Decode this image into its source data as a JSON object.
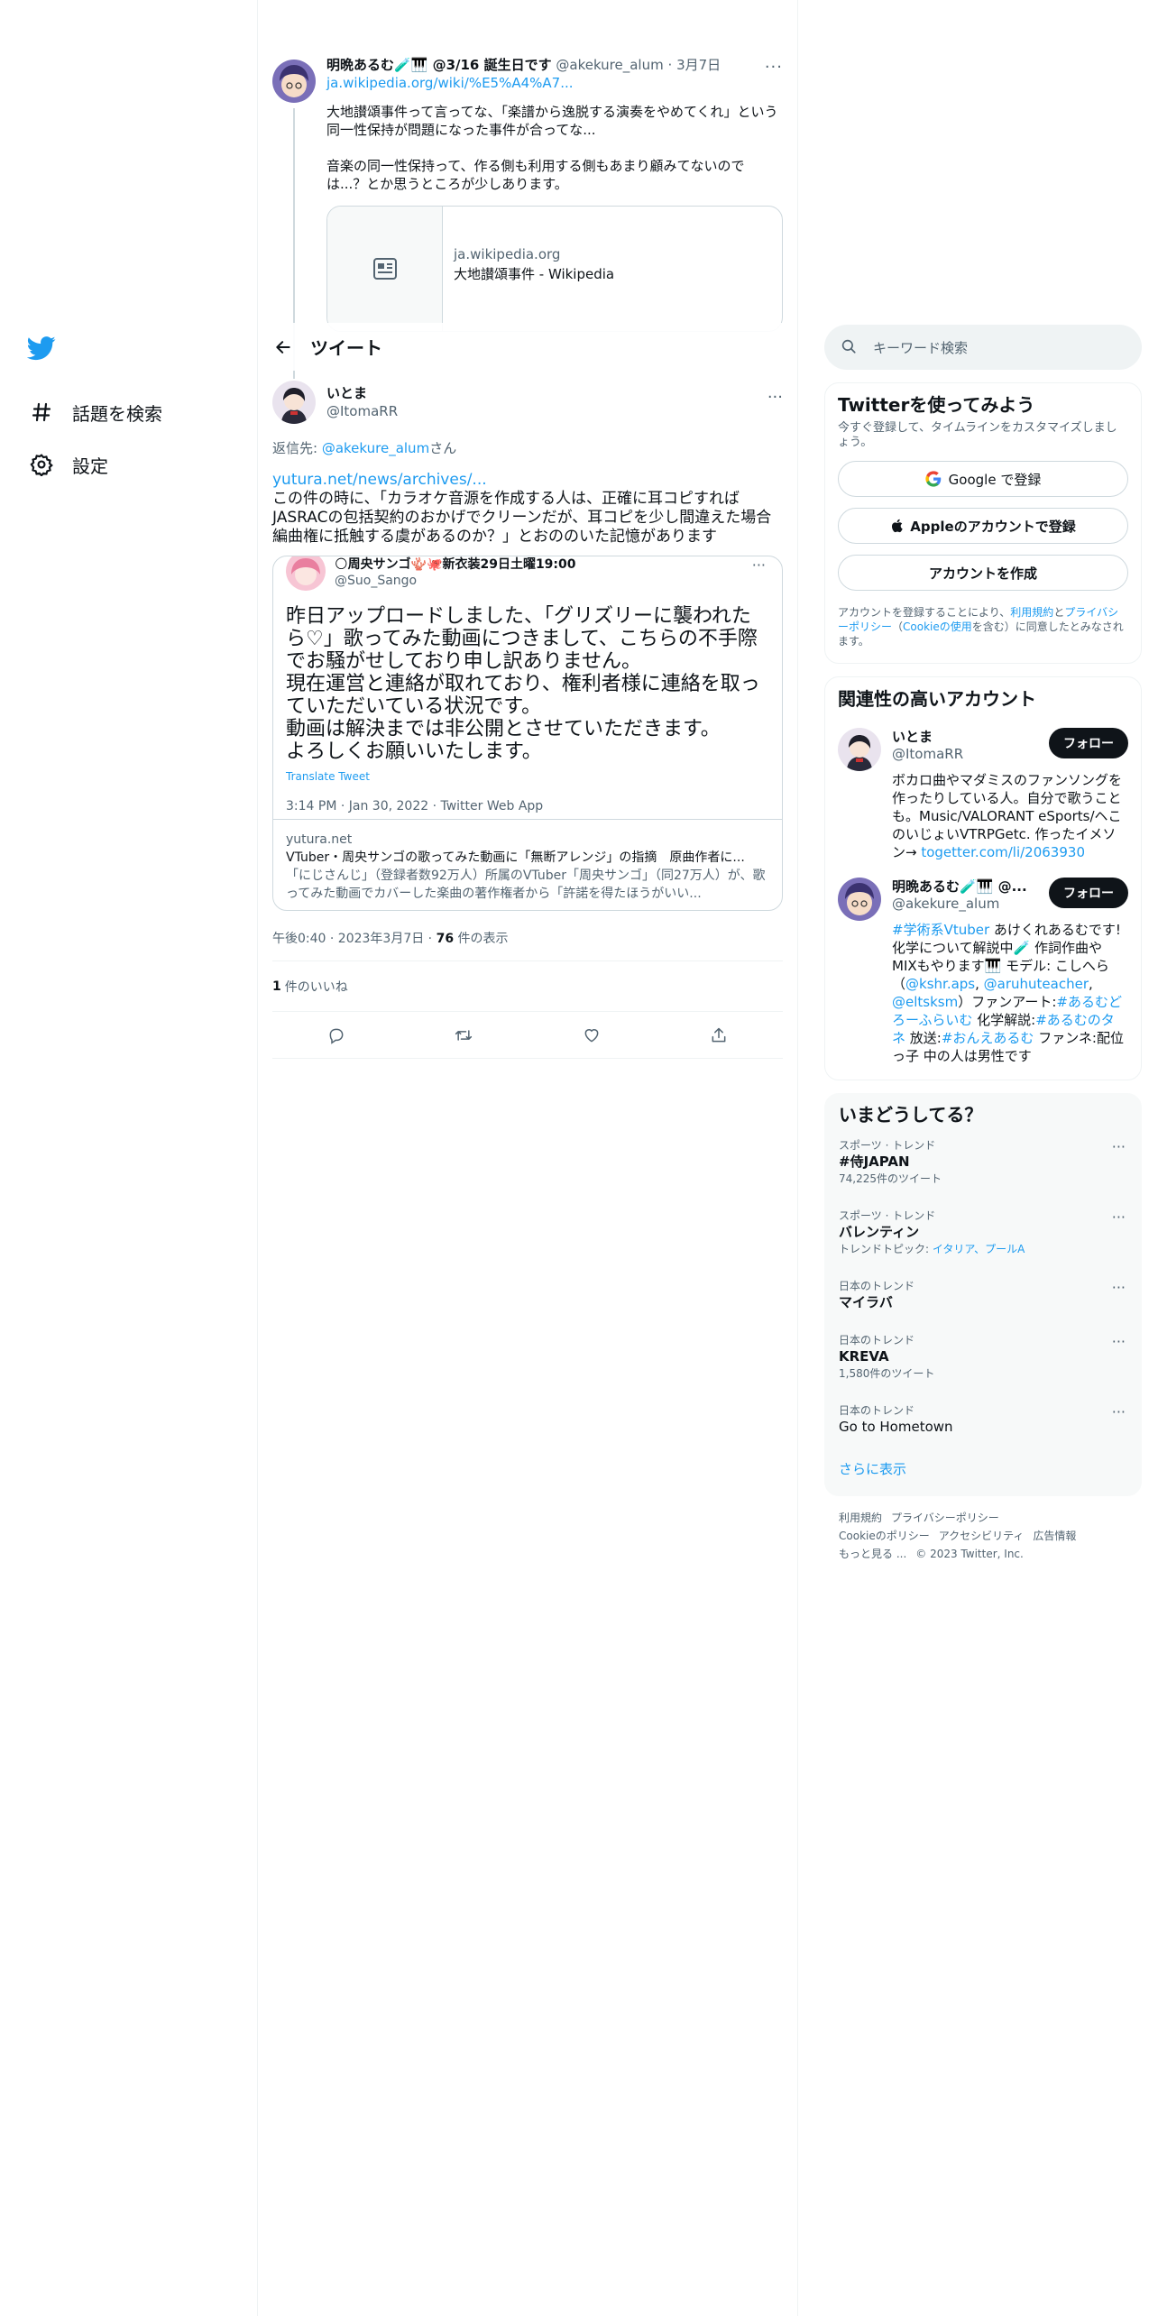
{
  "nav": {
    "items": [
      {
        "label": "話題を検索",
        "icon": "hashtag-icon"
      },
      {
        "label": "設定",
        "icon": "gear-icon"
      }
    ]
  },
  "parent_tweet": {
    "name": "明晩あるむ🧪🎹 @3/16 誕生日です",
    "handle": "@akekure_alum",
    "date": "3月7日",
    "link": "ja.wikipedia.org/wiki/%E5%A4%A7...",
    "text_1": "大地讃頌事件って言ってな、「楽譜から逸脱する演奏をやめてくれ」という同一性保持が問題になった事件が合ってな...",
    "text_2": "音楽の同一性保持って、作る側も利用する側もあまり顧みてないのでは...？とか思うところが少しあります。",
    "card_domain": "ja.wikipedia.org",
    "card_title": "大地讃頌事件 - Wikipedia"
  },
  "header": {
    "title": "ツイート"
  },
  "tweet": {
    "name": "いとま",
    "handle": "@ItomaRR",
    "reply_prefix": "返信先: ",
    "reply_to": "@akekure_alum",
    "reply_suffix": "さん",
    "link": "yutura.net/news/archives/...",
    "text": "この件の時に、「カラオケ音源を作成する人は、正確に耳コピすればJASRACの包括契約のおかげでクリーンだが、耳コピを少し間違えた場合編曲権に抵触する虞があるのか？」とおののいた記憶があります",
    "time": "午後0:40 · 2023年3月7日 · ",
    "views_count": "76",
    "views_label": " 件の表示",
    "likes_count": "1",
    "likes_label": "件のいいね"
  },
  "quote": {
    "name": "🌕周央サンゴ🪸🐙新衣装29日土曜19:00",
    "handle": "@Suo_Sango",
    "text": "昨日アップロードしました、「グリズリーに襲われたら♡」歌ってみた動画につきまして、こちらの不手際でお騒がせしており申し訳ありません。\n現在運営と連絡が取れており、権利者様に連絡を取っていただいている状況です。\n動画は解決までは非公開とさせていただきます。\nよろしくお願いいたします。",
    "translate": "Translate Tweet",
    "meta": "3:14 PM · Jan 30, 2022 · Twitter Web App",
    "card_domain": "yutura.net",
    "card_title": "VTuber・周央サンゴの歌ってみた動画に「無断アレンジ」の指摘　原曲作者に...",
    "card_desc": "「にじさんじ」（登録者数92万人）所属のVTuber「周央サンゴ」（同27万人）が、歌ってみた動画でカバーした楽曲の著作権者から「許諾を得たほうがいい..."
  },
  "search": {
    "placeholder": "キーワード検索"
  },
  "signup": {
    "title": "Twitterを使ってみよう",
    "subtitle": "今すぐ登録して、タイムラインをカスタマイズしましょう。",
    "google": "Google で登録",
    "apple": "Appleのアカウントで登録",
    "create": "アカウントを作成",
    "legal_1": "アカウントを登録することにより、",
    "legal_terms": "利用規約",
    "legal_2": "と",
    "legal_privacy": "プライバシーポリシー",
    "legal_3": "（",
    "legal_cookie": "Cookieの使用",
    "legal_4": "を含む）に同意したとみなされます。"
  },
  "related": {
    "title": "関連性の高いアカウント",
    "follow_label": "フォロー",
    "accounts": [
      {
        "name": "いとま",
        "handle": "@ItomaRR",
        "bio": "ボカロ曲やマダミスのファンソングを作ったりしている人。自分で歌うことも。Music/VALORANT eSports/ヘこのいじょいVTRPGetc. 作ったイメソン→ ",
        "bio_link": "togetter.com/li/2063930"
      },
      {
        "name": "明晩あるむ🧪🎹 @...",
        "handle": "@akekure_alum",
        "bio_tag": "#学術系Vtuber",
        "bio_a": " あけくれあるむです!化学について解説中🧪 作詞作曲やMIXもやります🎹 モデル: こしへら（",
        "m1": "@kshr.aps",
        "sep1": ", ",
        "m2": "@aruhuteacher",
        "sep2": ", ",
        "m3": "@eltsksm",
        "bio_b": "）ファンアート:",
        "t1": "#あるむどろーふらいむ",
        "bio_c": " 化学解説:",
        "t2": "#あるむのタネ",
        "bio_d": " 放送:",
        "t3": "#おんえあるむ",
        "bio_e": " ファンネ:配位っ子 中の人は男性です"
      }
    ]
  },
  "trends": {
    "title": "いまどうしてる？",
    "items": [
      {
        "category": "スポーツ · トレンド",
        "topic": "#侍JAPAN",
        "extra": "74,225件のツイート"
      },
      {
        "category": "スポーツ · トレンド",
        "topic": "バレンティン",
        "extra_prefix": "トレンドトピック: ",
        "extra_link": "イタリア、プールA"
      },
      {
        "category": "日本のトレンド",
        "topic": "マイラバ"
      },
      {
        "category": "日本のトレンド",
        "topic": "KREVA",
        "extra": "1,580件のツイート"
      },
      {
        "category": "日本のトレンド",
        "topic": "Go to Hometown"
      }
    ],
    "show_more": "さらに表示"
  },
  "footer": {
    "links": [
      "利用規約",
      "プライバシーポリシー",
      "Cookieのポリシー",
      "アクセシビリティ",
      "広告情報",
      "もっと見る ..."
    ],
    "copyright": "© 2023 Twitter, Inc."
  },
  "colors": {
    "accent": "#1d9bf0",
    "text": "#0f1419",
    "muted": "#536471",
    "border": "#eff3f4"
  }
}
